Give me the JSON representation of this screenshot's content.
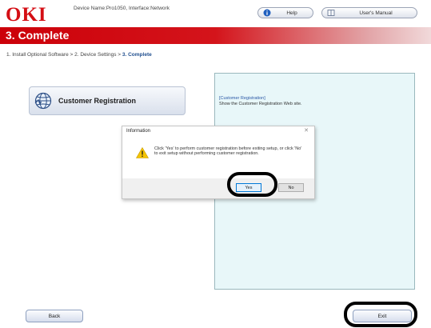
{
  "header": {
    "logo": "OKI",
    "device_info": "Device Name:Pro1050, Interface:Network",
    "help_label": "Help",
    "manual_label": "User's Manual",
    "help_icon": "info-circle-icon",
    "manual_icon": "book-icon"
  },
  "title": "3. Complete",
  "breadcrumb": {
    "prefix": "1. Install Optional Software > 2. Device Settings > ",
    "current": "3. Complete"
  },
  "registration_button": {
    "label": "Customer Registration",
    "icon": "globe-icon"
  },
  "info_panel": {
    "title": "[Customer Registration]",
    "description": "Show the Customer Registration Web site."
  },
  "dialog": {
    "title": "Information",
    "close": "✕",
    "message": "Click 'Yes' to perform customer registration before exiting setup, or click 'No' to exit setup without performing customer registration.",
    "yes_label": "Yes",
    "no_label": "No",
    "icon": "warning-icon"
  },
  "footer": {
    "back_label": "Back",
    "exit_label": "Exit"
  },
  "colors": {
    "brand_red": "#d40e14",
    "title_bar": "#cc0009",
    "panel_bg": "#e8f7f9",
    "link_blue": "#2b58a6"
  }
}
